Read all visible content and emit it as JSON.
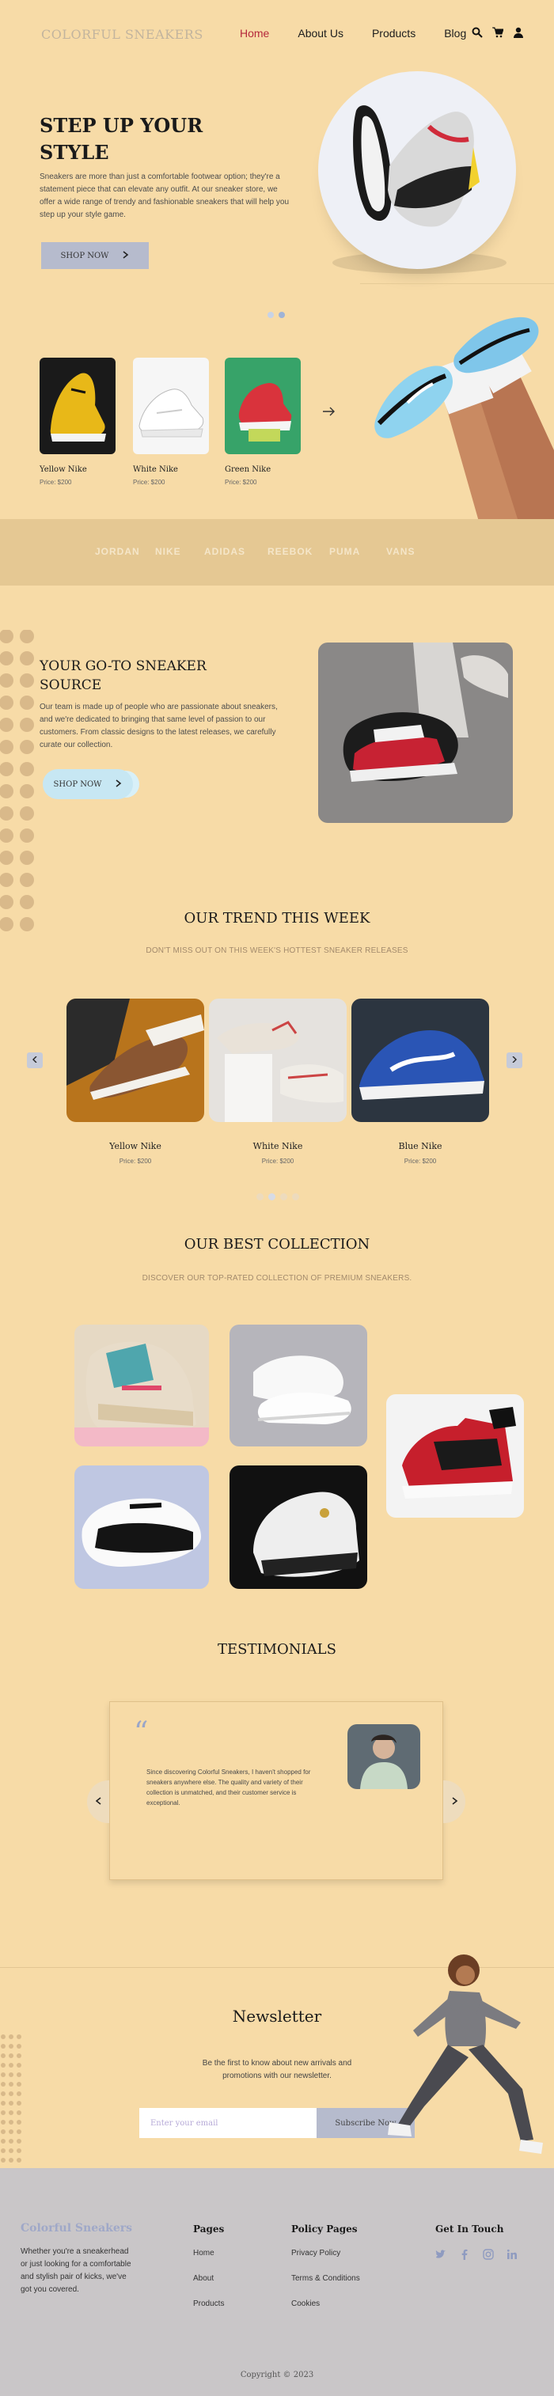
{
  "header": {
    "logo": "COLORFUL SNEAKERS",
    "nav": [
      "Home",
      "About Us",
      "Products",
      "Blog"
    ],
    "active_nav": "Home",
    "icons": [
      "search-icon",
      "cart-icon",
      "user-icon"
    ]
  },
  "hero": {
    "title": "STEP UP YOUR STYLE",
    "text": "Sneakers are more than just a comfortable footwear option; they're a statement piece that can elevate any outfit. At our sneaker store, we offer a wide range of trendy and fashionable sneakers that will help you step up your style game.",
    "button": "SHOP NOW",
    "products": [
      {
        "name": "Yellow Nike",
        "price": "Price: $200"
      },
      {
        "name": "White Nike",
        "price": "Price: $200"
      },
      {
        "name": "Green Nike",
        "price": "Price: $200"
      }
    ]
  },
  "brands": [
    "JORDAN",
    "NIKE",
    "ADIDAS",
    "REEBOK",
    "PUMA",
    "VANS"
  ],
  "about": {
    "title": "YOUR GO-TO SNEAKER SOURCE",
    "text": "Our team is made up of people who are passionate about sneakers, and we're dedicated to bringing that same level of passion to our customers. From classic designs to the latest releases, we carefully curate our collection.",
    "button": "SHOP NOW"
  },
  "trend": {
    "title": "OUR TREND THIS WEEK",
    "subtitle": "DON'T MISS OUT ON THIS WEEK'S HOTTEST SNEAKER RELEASES",
    "items": [
      {
        "name": "Yellow Nike",
        "price": "Price: $200"
      },
      {
        "name": "White Nike",
        "price": "Price: $200"
      },
      {
        "name": "Blue Nike",
        "price": "Price: $200"
      }
    ]
  },
  "collection": {
    "title": "OUR BEST COLLECTION",
    "subtitle": "DISCOVER OUR TOP-RATED COLLECTION OF PREMIUM SNEAKERS."
  },
  "testimonials": {
    "title": "TESTIMONIALS",
    "quote": "Since discovering Colorful Sneakers, I haven't shopped for sneakers anywhere else. The quality and variety of their collection is unmatched, and their customer service is exceptional."
  },
  "newsletter": {
    "title": "Newsletter",
    "text": "Be the first to know about new arrivals and promotions with our newsletter.",
    "placeholder": "Enter your email",
    "button": "Subscribe Now"
  },
  "footer": {
    "logo": "Colorful Sneakers",
    "desc": "Whether you're a sneakerhead or just looking for a comfortable and stylish pair of kicks, we've got you covered.",
    "pages_title": "Pages",
    "pages": [
      "Home",
      "About",
      "Products"
    ],
    "policy_title": "Policy Pages",
    "policy": [
      "Privacy Policy",
      "Terms & Conditions",
      "Cookies"
    ],
    "touch_title": "Get In Touch",
    "social": [
      "twitter-icon",
      "facebook-icon",
      "instagram-icon",
      "linkedin-icon"
    ],
    "copyright": "Copyright © 2023"
  }
}
